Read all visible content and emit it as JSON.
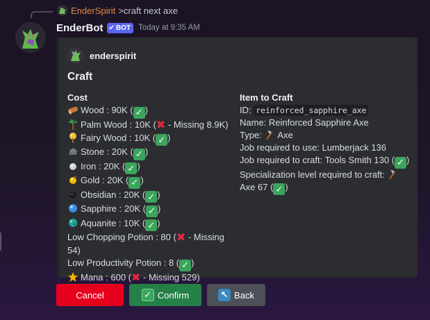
{
  "reply": {
    "author": "EnderSpirit",
    "text": ">craft next axe"
  },
  "message": {
    "bot_name": "EnderBot",
    "badge": "BOT",
    "timestamp": "Today at 9:35 AM"
  },
  "embed": {
    "author": "enderspirit",
    "title": "Craft",
    "cost": {
      "heading": "Cost",
      "items": [
        {
          "icon": "wood-icon",
          "text": "Wood : 90K (",
          "status": "ok",
          "tail": ")"
        },
        {
          "icon": "palm-tree-icon",
          "text": "Palm Wood : 10K (",
          "status": "missing",
          "tail": " - Missing 8.9K)"
        },
        {
          "icon": "fairy-wood-icon",
          "text": "Fairy Wood : 10K (",
          "status": "ok",
          "tail": ")"
        },
        {
          "icon": "stone-icon",
          "text": "Stone : 20K (",
          "status": "ok",
          "tail": ")"
        },
        {
          "icon": "iron-icon",
          "text": "Iron : 20K (",
          "status": "ok",
          "tail": ")"
        },
        {
          "icon": "gold-icon",
          "text": "Gold : 20K (",
          "status": "ok",
          "tail": ")"
        },
        {
          "icon": "obsidian-icon",
          "text": "Obsidian : 20K (",
          "status": "ok",
          "tail": ")"
        },
        {
          "icon": "sapphire-icon",
          "text": "Sapphire : 20K (",
          "status": "ok",
          "tail": ")"
        },
        {
          "icon": "aquanite-icon",
          "text": "Aquanite : 10K (",
          "status": "ok",
          "tail": ")"
        }
      ],
      "chopping_potion": {
        "text": "Low Chopping Potion : 80 (",
        "tail": " - Missing 54)"
      },
      "productivity_potion": {
        "text": "Low Productivity Potion : 8 (",
        "tail": ")"
      },
      "mana": {
        "text": "Mana : 600 (",
        "tail": " - Missing 529)"
      }
    },
    "item": {
      "heading": "Item to Craft",
      "id_label": "ID: ",
      "id_value": "reinforced_sapphire_axe",
      "name": "Name: Reinforced Sapphire Axe",
      "type_label": "Type: ",
      "type_value": "Axe",
      "job_use": "Job required to use: Lumberjack 136",
      "job_craft": "Job required to craft: Tools Smith 130 (",
      "spec_label": "Specialization level required to craft: ",
      "spec_value": "Axe 67 ("
    }
  },
  "buttons": {
    "cancel": "Cancel",
    "confirm": "Confirm",
    "back": "Back"
  },
  "colors": {
    "cancel": "#e6001e",
    "confirm": "#248046",
    "back": "#4e5058",
    "badge": "#5865f2",
    "reply_author": "#e08a47"
  }
}
